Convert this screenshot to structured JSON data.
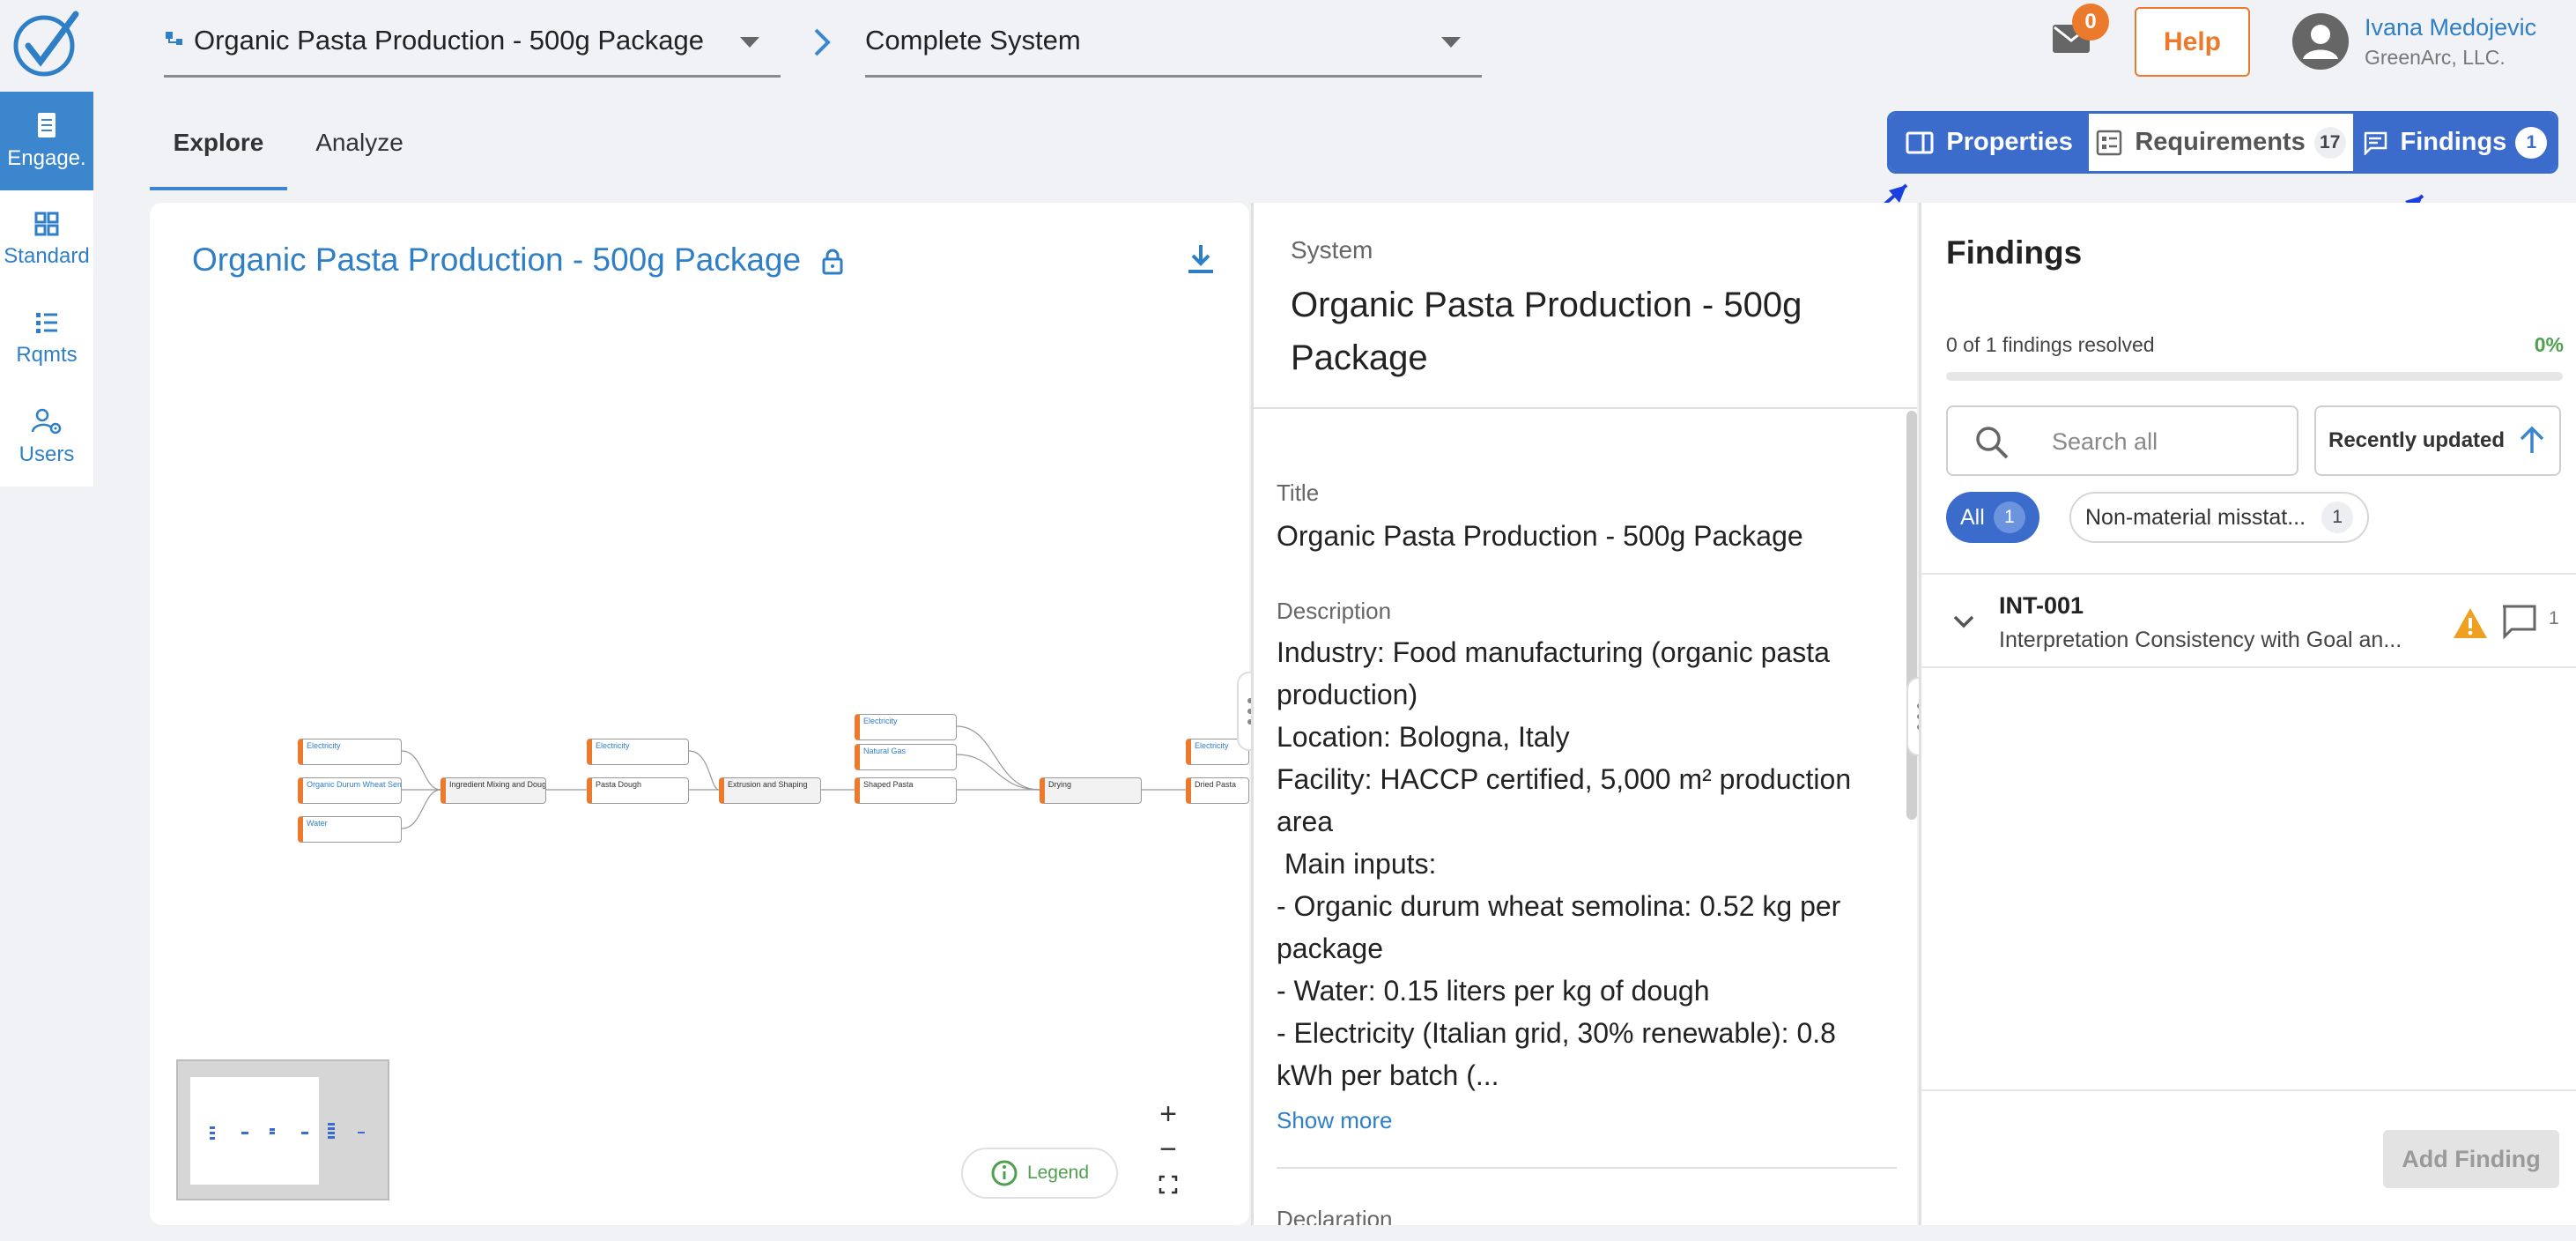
{
  "header": {
    "system_select": "Organic Pasta Production - 500g Package",
    "scope_select": "Complete System",
    "mail_count": "0",
    "help_label": "Help",
    "user_name": "Ivana Medojevic",
    "user_org": "GreenArc, LLC."
  },
  "nav": {
    "items": [
      {
        "label": "Engage.",
        "icon": "document-icon"
      },
      {
        "label": "Standard",
        "icon": "grid-icon"
      },
      {
        "label": "Rqmts",
        "icon": "list-icon"
      },
      {
        "label": "Users",
        "icon": "users-gear-icon"
      }
    ]
  },
  "tabs": {
    "explore": "Explore",
    "analyze": "Analyze"
  },
  "panel_tabs": {
    "properties": "Properties",
    "requirements": "Requirements",
    "requirements_count": "17",
    "findings": "Findings",
    "findings_count": "1"
  },
  "canvas": {
    "title": "Organic Pasta Production - 500g Package",
    "legend": "Legend",
    "nodes": [
      "Electricity",
      "Organic Durum Wheat Semo...",
      "Water",
      "Ingredient Mixing and Doug...",
      "Electricity",
      "Pasta Dough",
      "Extrusion and Shaping",
      "Electricity",
      "Natural Gas",
      "Shaped Pasta",
      "Drying",
      "Electricity",
      "Dried Pasta"
    ]
  },
  "properties": {
    "kind": "System",
    "heading": "Organic Pasta Production - 500g Package",
    "title_label": "Title",
    "title_value": "Organic Pasta Production - 500g Package",
    "description_label": "Description",
    "description_lines": [
      "Industry: Food manufacturing (organic pasta",
      "production)",
      "Location: Bologna, Italy",
      "Facility: HACCP certified, 5,000 m² production",
      "area",
      " Main inputs:",
      "- Organic durum wheat semolina: 0.52 kg per",
      "package",
      "- Water: 0.15 liters per kg of dough",
      "- Electricity (Italian grid, 30% renewable): 0.8",
      "kWh per batch (..."
    ],
    "show_more": "Show more",
    "declaration_label": "Declaration"
  },
  "findings": {
    "title": "Findings",
    "progress_text": "0 of 1 findings resolved",
    "progress_pct": "0%",
    "progress_value": 0,
    "search_placeholder": "Search all",
    "sort_label": "Recently updated",
    "chips": [
      {
        "label": "All",
        "count": "1"
      },
      {
        "label": "Non-material misstat...",
        "count": "1"
      }
    ],
    "items": [
      {
        "id": "INT-001",
        "description": "Interpretation Consistency with Goal an...",
        "comments": "1"
      }
    ],
    "add_label": "Add Finding"
  },
  "colors": {
    "accent": "#3b6ccc",
    "link": "#2f7fc7",
    "warning": "#ec7a2c",
    "success": "#4fa14f"
  }
}
